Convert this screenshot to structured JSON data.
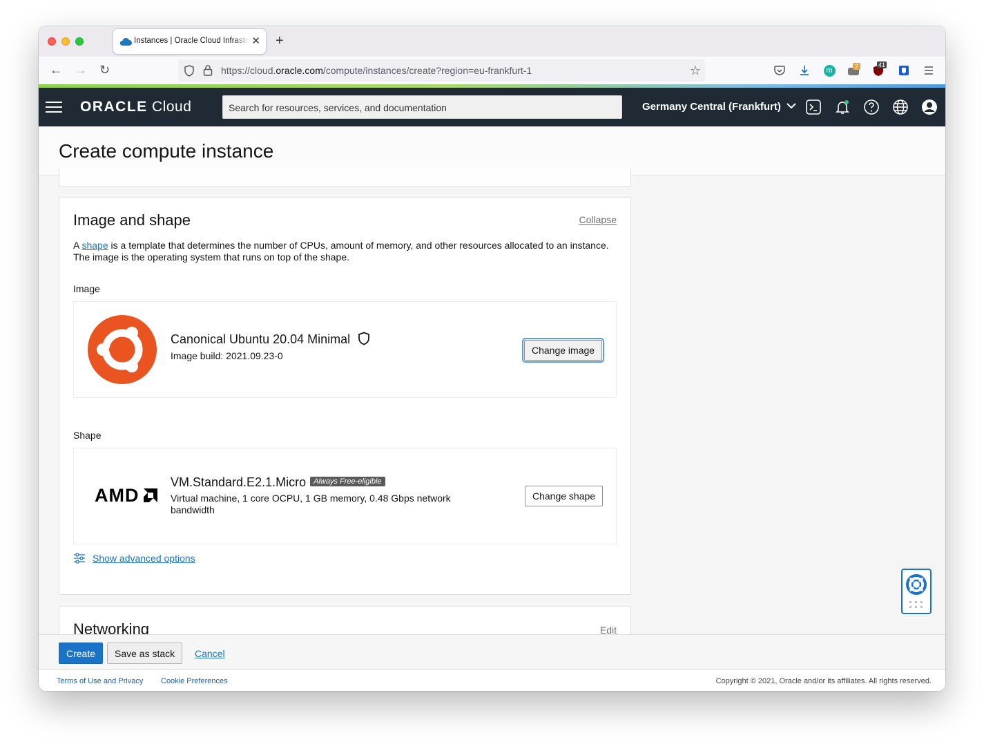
{
  "browser": {
    "tab_title": "Instances | Oracle Cloud Infrastructure",
    "url_prefix": "https://cloud.",
    "url_host": "oracle.com",
    "url_path": "/compute/instances/create?region=eu-frankfurt-1",
    "extensions": {
      "badge_one": "2",
      "badge_two": "41",
      "m_letter": "m"
    }
  },
  "header": {
    "logo_brand": "ORACLE",
    "logo_product": "Cloud",
    "search_placeholder": "Search for resources, services, and documentation",
    "region": "Germany Central (Frankfurt)"
  },
  "page": {
    "title": "Create compute instance"
  },
  "image_and_shape": {
    "heading": "Image and shape",
    "collapse_label": "Collapse",
    "description_prefix": "A ",
    "description_link": "shape",
    "description_line1_rest": " is a template that determines the number of CPUs, amount of memory, and other resources allocated to an instance.",
    "description_line2": "The image is the operating system that runs on top of the shape.",
    "image_label": "Image",
    "image_name": "Canonical Ubuntu 20.04 Minimal",
    "image_build": "Image build: 2021.09.23-0",
    "change_image_label": "Change image",
    "shape_label": "Shape",
    "shape_vendor": "AMD",
    "shape_name": "VM.Standard.E2.1.Micro",
    "shape_badge": "Always Free-eligible",
    "shape_details": "Virtual machine, 1 core OCPU, 1 GB memory, 0.48 Gbps network bandwidth",
    "change_shape_label": "Change shape",
    "advanced_options_label": "Show advanced options"
  },
  "networking": {
    "heading": "Networking",
    "edit_label": "Edit"
  },
  "actions": {
    "create_label": "Create",
    "save_stack_label": "Save as stack",
    "cancel_label": "Cancel"
  },
  "footer": {
    "terms_label": "Terms of Use and Privacy",
    "cookie_label": "Cookie Preferences",
    "copyright": "Copyright © 2021, Oracle and/or its affiliates. All rights reserved."
  },
  "colors": {
    "header_bg": "#1f2a35",
    "primary_button": "#1b73c7",
    "link": "#1a73c6",
    "ubuntu_orange": "#e95420"
  }
}
